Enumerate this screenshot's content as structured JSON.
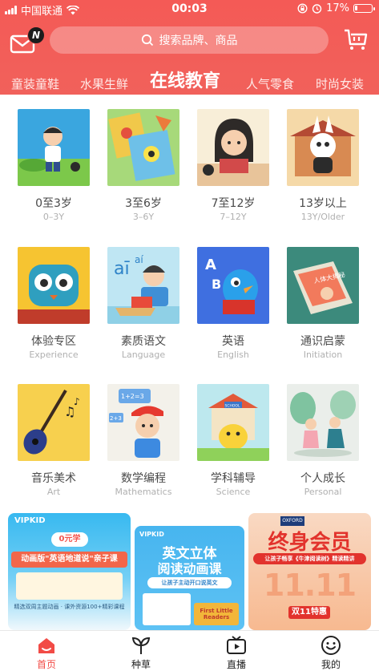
{
  "status_bar": {
    "carrier": "中国联通",
    "time": "00:03",
    "battery": "17%",
    "battery_level": 0.17
  },
  "header": {
    "mail_badge": "N",
    "search_placeholder": "搜索品牌、商品",
    "categories": [
      {
        "label": "童装童鞋",
        "active": false
      },
      {
        "label": "水果生鲜",
        "active": false
      },
      {
        "label": "在线教育",
        "active": true
      },
      {
        "label": "人气零食",
        "active": false
      },
      {
        "label": "时尚女装",
        "active": false
      }
    ]
  },
  "grid": [
    {
      "zh": "0至3岁",
      "en": "0–3Y"
    },
    {
      "zh": "3至6岁",
      "en": "3–6Y"
    },
    {
      "zh": "7至12岁",
      "en": "7–12Y"
    },
    {
      "zh": "13岁以上",
      "en": "13Y/Older"
    },
    {
      "zh": "体验专区",
      "en": "Experience"
    },
    {
      "zh": "素质语文",
      "en": "Language"
    },
    {
      "zh": "英语",
      "en": "English"
    },
    {
      "zh": "通识启蒙",
      "en": "Initiation"
    },
    {
      "zh": "音乐美术",
      "en": "Art"
    },
    {
      "zh": "数学编程",
      "en": "Mathematics"
    },
    {
      "zh": "学科辅导",
      "en": "Science"
    },
    {
      "zh": "个人成长",
      "en": "Personal"
    }
  ],
  "thumb_text": {
    "phonics": "aī",
    "phonics_2": "aí",
    "english_letter_a": "A",
    "english_letter_b": "B",
    "book_title": "人体大揭秘",
    "math_top": "1+2=3",
    "math_mid": "2+3",
    "school_sign": "SCHOOL"
  },
  "banners": [
    {
      "logo": "VIPKID",
      "tag": "0元学",
      "headline": "动画版\"英语地道说\"亲子课",
      "sub": "精选双周主题动画 · 课外资源100+精彩课程"
    },
    {
      "logo": "VIPKID",
      "headline_1": "英文立体",
      "headline_2": "阅读动画课",
      "sub": "让孩子主动开口说英文",
      "book": "First Little Readers"
    },
    {
      "logo": "OXFORD",
      "headline": "终身会员",
      "sub": "让孩子畅享《牛津阅读树》精读精讲",
      "big": "11.11",
      "tag": "双11特惠"
    }
  ],
  "tabbar": [
    {
      "label": "首页",
      "icon": "home-icon",
      "active": true
    },
    {
      "label": "种草",
      "icon": "sprout-icon",
      "active": false
    },
    {
      "label": "直播",
      "icon": "tv-icon",
      "active": false
    },
    {
      "label": "我的",
      "icon": "smiley-icon",
      "active": false
    }
  ],
  "colors": {
    "brand_red": "#f45a56",
    "active_tab": "#f24b46"
  }
}
